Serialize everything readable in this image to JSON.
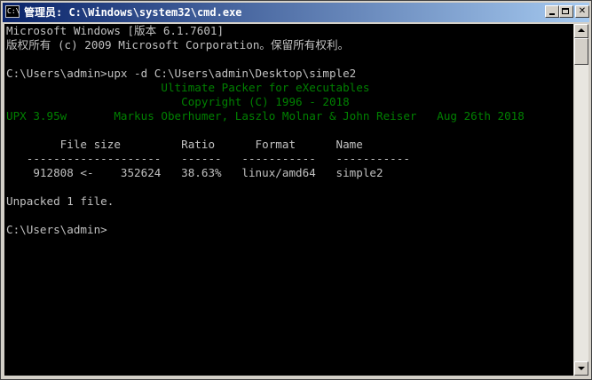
{
  "window": {
    "title": "管理员: C:\\Windows\\system32\\cmd.exe",
    "icon_label": "C:\\"
  },
  "console": {
    "lines": [
      "Microsoft Windows [版本 6.1.7601]",
      "版权所有 (c) 2009 Microsoft Corporation。保留所有权利。",
      "",
      "C:\\Users\\admin>upx -d C:\\Users\\admin\\Desktop\\simple2",
      "                       Ultimate Packer for eXecutables",
      "                          Copyright (C) 1996 - 2018",
      "UPX 3.95w       Markus Oberhumer, Laszlo Molnar & John Reiser   Aug 26th 2018",
      "",
      "        File size         Ratio      Format      Name",
      "   --------------------   ------   -----------   -----------",
      "    912808 <-    352624   38.63%   linux/amd64   simple2",
      "",
      "Unpacked 1 file.",
      "",
      "C:\\Users\\admin>"
    ]
  },
  "colors": {
    "console_bg": "#000000",
    "console_text": "#c0c0c0",
    "upx_banner_text": "#008000",
    "titlebar_start": "#0a246a",
    "titlebar_end": "#a6caf0"
  }
}
